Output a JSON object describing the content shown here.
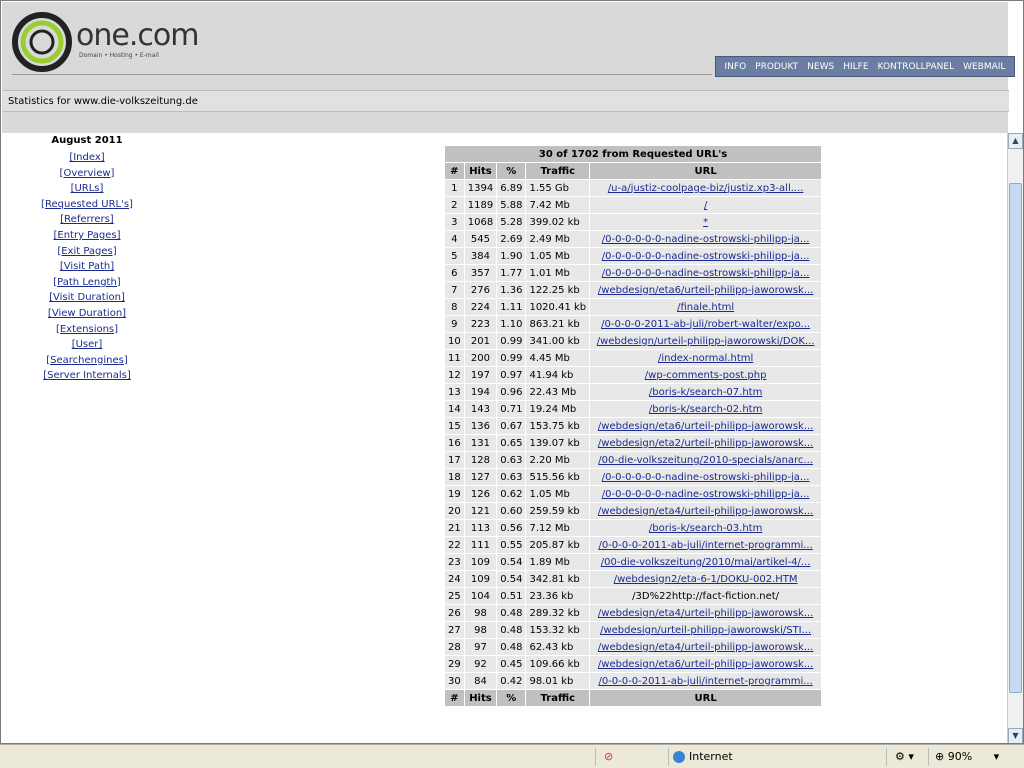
{
  "brand": {
    "name": "one.com",
    "tagline": "Domain • Hosting • E-mail"
  },
  "topnav": [
    "INFO",
    "PRODUKT",
    "NEWS",
    "HILFE",
    "KONTROLLPANEL",
    "WEBMAIL"
  ],
  "stats_title": "Statistics for www.die-volkszeitung.de",
  "sidebar": {
    "month": "August 2011",
    "links": [
      "[Index]",
      "[Overview]",
      "[URLs]",
      "[Requested URL's]",
      "[Referrers]",
      "[Entry Pages]",
      "[Exit Pages]",
      "[Visit Path]",
      "[Path Length]",
      "[Visit Duration]",
      "[View Duration]",
      "[Extensions]",
      "[User]",
      "[Searchengines]",
      "[Server Internals]"
    ]
  },
  "table": {
    "caption": "30 of 1702 from Requested URL's",
    "headers": [
      "#",
      "Hits",
      "%",
      "Traffic",
      "URL"
    ],
    "rows": [
      [
        "1",
        "1394",
        "6.89",
        "1.55 Gb",
        "/u-a/justiz-coolpage-biz/justiz.xp3-all....",
        true
      ],
      [
        "2",
        "1189",
        "5.88",
        "7.42 Mb",
        "/",
        true
      ],
      [
        "3",
        "1068",
        "5.28",
        "399.02 kb",
        "*",
        true
      ],
      [
        "4",
        "545",
        "2.69",
        "2.49 Mb",
        "/0-0-0-0-0-0-nadine-ostrowski-philipp-ja...",
        true
      ],
      [
        "5",
        "384",
        "1.90",
        "1.05 Mb",
        "/0-0-0-0-0-0-nadine-ostrowski-philipp-ja...",
        true
      ],
      [
        "6",
        "357",
        "1.77",
        "1.01 Mb",
        "/0-0-0-0-0-0-nadine-ostrowski-philipp-ja...",
        true
      ],
      [
        "7",
        "276",
        "1.36",
        "122.25 kb",
        "/webdesign/eta6/urteil-philipp-jaworowsk...",
        true
      ],
      [
        "8",
        "224",
        "1.11",
        "1020.41 kb",
        "/finale.html",
        true
      ],
      [
        "9",
        "223",
        "1.10",
        "863.21 kb",
        "/0-0-0-0-2011-ab-juli/robert-walter/expo...",
        true
      ],
      [
        "10",
        "201",
        "0.99",
        "341.00 kb",
        "/webdesign/urteil-philipp-jaworowski/DOK...",
        true
      ],
      [
        "11",
        "200",
        "0.99",
        "4.45 Mb",
        "/index-normal.html",
        true
      ],
      [
        "12",
        "197",
        "0.97",
        "41.94 kb",
        "/wp-comments-post.php",
        true
      ],
      [
        "13",
        "194",
        "0.96",
        "22.43 Mb",
        "/boris-k/search-07.htm",
        true
      ],
      [
        "14",
        "143",
        "0.71",
        "19.24 Mb",
        "/boris-k/search-02.htm",
        true
      ],
      [
        "15",
        "136",
        "0.67",
        "153.75 kb",
        "/webdesign/eta6/urteil-philipp-jaworowsk...",
        true
      ],
      [
        "16",
        "131",
        "0.65",
        "139.07 kb",
        "/webdesign/eta2/urteil-philipp-jaworowsk...",
        true
      ],
      [
        "17",
        "128",
        "0.63",
        "2.20 Mb",
        "/00-die-volkszeitung/2010-specials/anarc...",
        true
      ],
      [
        "18",
        "127",
        "0.63",
        "515.56 kb",
        "/0-0-0-0-0-0-nadine-ostrowski-philipp-ja...",
        true
      ],
      [
        "19",
        "126",
        "0.62",
        "1.05 Mb",
        "/0-0-0-0-0-0-nadine-ostrowski-philipp-ja...",
        true
      ],
      [
        "20",
        "121",
        "0.60",
        "259.59 kb",
        "/webdesign/eta4/urteil-philipp-jaworowsk...",
        true
      ],
      [
        "21",
        "113",
        "0.56",
        "7.12 Mb",
        "/boris-k/search-03.htm",
        true
      ],
      [
        "22",
        "111",
        "0.55",
        "205.87 kb",
        "/0-0-0-0-2011-ab-juli/internet-programmi...",
        true
      ],
      [
        "23",
        "109",
        "0.54",
        "1.89 Mb",
        "/00-die-volkszeitung/2010/mai/artikel-4/...",
        true
      ],
      [
        "24",
        "109",
        "0.54",
        "342.81 kb",
        "/webdesign2/eta-6-1/DOKU-002.HTM",
        true
      ],
      [
        "25",
        "104",
        "0.51",
        "23.36 kb",
        "/3D%22http://fact-fiction.net/",
        false
      ],
      [
        "26",
        "98",
        "0.48",
        "289.32 kb",
        "/webdesign/eta4/urteil-philipp-jaworowsk...",
        true
      ],
      [
        "27",
        "98",
        "0.48",
        "153.32 kb",
        "/webdesign/urteil-philipp-jaworowski/STI...",
        true
      ],
      [
        "28",
        "97",
        "0.48",
        "62.43 kb",
        "/webdesign/eta4/urteil-philipp-jaworowsk...",
        true
      ],
      [
        "29",
        "92",
        "0.45",
        "109.66 kb",
        "/webdesign/eta6/urteil-philipp-jaworowsk...",
        true
      ],
      [
        "30",
        "84",
        "0.42",
        "98.01 kb",
        "/0-0-0-0-2011-ab-juli/internet-programmi...",
        true
      ]
    ]
  },
  "statusbar": {
    "zone": "Internet",
    "zoom": "90%"
  }
}
